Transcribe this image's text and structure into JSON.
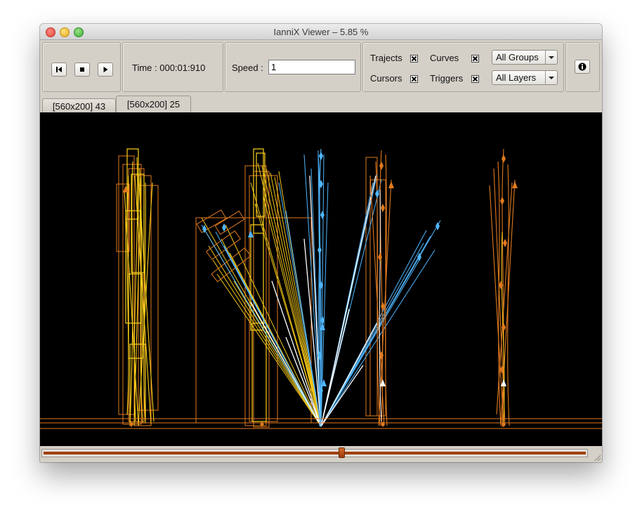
{
  "window": {
    "title": "IanniX Viewer – 5.85 %"
  },
  "transport": {
    "rewind_icon": "skip-to-start-icon",
    "stop_icon": "stop-icon",
    "play_icon": "play-icon"
  },
  "time": {
    "label": "Time : 000:01:910"
  },
  "speed": {
    "label": "Speed :",
    "value": "1"
  },
  "display": {
    "trajects_label": "Trajects",
    "curves_label": "Curves",
    "cursors_label": "Cursors",
    "triggers_label": "Triggers",
    "trajects_checked": true,
    "curves_checked": true,
    "cursors_checked": true,
    "triggers_checked": true
  },
  "groups": {
    "selected": "All Groups"
  },
  "layers": {
    "selected": "All Layers"
  },
  "info": {
    "icon": "info-icon"
  },
  "tabs": [
    {
      "label": "[560x200] 43",
      "active": false
    },
    {
      "label": "[560x200] 25",
      "active": true
    }
  ],
  "timeline": {
    "position": 0.55
  },
  "colors": {
    "canvas_bg": "#000000",
    "orange": "#e07a1f",
    "yellow": "#ffd21a",
    "cyan": "#4fb6ff",
    "white": "#ffffff"
  }
}
